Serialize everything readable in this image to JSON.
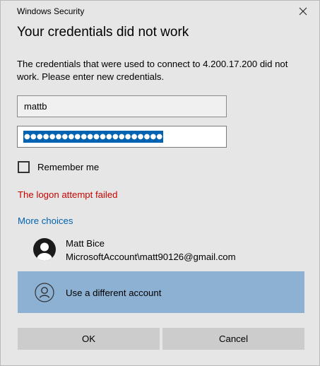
{
  "window": {
    "title": "Windows Security",
    "close_icon": "close-icon"
  },
  "dialog": {
    "heading": "Your credentials did not work",
    "message": "The credentials that were used to connect to 4.200.17.200 did not work. Please enter new credentials."
  },
  "form": {
    "username_value": "mattb",
    "password_masked": "●●●●●●●●●●●●●●●●●●●●●●",
    "password_selected": true,
    "remember_me_label": "Remember me",
    "remember_me_checked": false
  },
  "error": {
    "text": "The logon attempt failed",
    "color": "#c50500"
  },
  "more_choices": {
    "label": "More choices",
    "color": "#0063b1"
  },
  "accounts": [
    {
      "name": "Matt Bice",
      "detail": "MicrosoftAccount\\matt90126@gmail.com",
      "icon": "user-avatar-icon",
      "selected": false
    },
    {
      "name": "Use a different account",
      "icon": "user-outline-icon",
      "selected": true,
      "selected_color": "#8cb1d3"
    }
  ],
  "buttons": {
    "ok_label": "OK",
    "cancel_label": "Cancel"
  }
}
